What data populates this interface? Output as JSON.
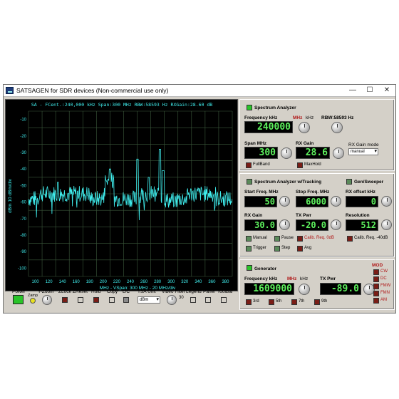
{
  "window": {
    "title": "SATSAGEN for SDR devices (Non-commercial use only)",
    "minimize": "—",
    "maximize": "☐",
    "close": "✕"
  },
  "graph": {
    "header": "SA - FCent.:240,000 kHz Span:300 MHz RBW:58593 Hz RXGain:28.60 dB",
    "footer": "MHz - VSpan: 300 MHz - 20 MHz/div",
    "ylabel": "dBm 10 dBm/div",
    "yticks": [
      "-10",
      "-20",
      "-30",
      "-40",
      "-50",
      "-60",
      "-70",
      "-80",
      "-90",
      "-100"
    ],
    "xticks": [
      "100",
      "120",
      "140",
      "160",
      "180",
      "200",
      "220",
      "240",
      "260",
      "280",
      "300",
      "320",
      "340",
      "360",
      "380"
    ],
    "trace_color": "#40f0f0"
  },
  "bottombar": {
    "power": "Power",
    "yzoom": "Y-Zoom",
    "zamp": "Zamp",
    "zlock": "ZLock",
    "zreset": "ZReset",
    "hold": "Hold",
    "copy": "Copy",
    "lc": "L/C",
    "tsa_unit": "TSA Unit",
    "tsa_value": "dBm",
    "video_filter": "Video Filter",
    "video_value": "30",
    "legend": "Legend",
    "panel": "Panel",
    "toolbar": "ToolBar"
  },
  "sa": {
    "title": "Spectrum Analyzer",
    "freq_label": "Frequency kHz",
    "unit_mhz": "MHz",
    "unit_khz": "kHz",
    "rbw": "RBW:58593 Hz",
    "freq_value": "240000",
    "span_label": "Span MHz",
    "span_value": "300",
    "gain_label": "RX Gain",
    "gain_value": "28.6",
    "gainmode_label": "RX Gain mode",
    "gainmode_value": "manual",
    "fullband": "FullBand",
    "maxhold": "MaxHold"
  },
  "tracking": {
    "title": "Spectrum Analyzer w/Tracking",
    "gen_title": "Gen/Sweeper",
    "start_label": "Start Freq. MHz",
    "start_value": "50",
    "stop_label": "Stop Freq. MHz",
    "stop_value": "6000",
    "offset_label": "RX offset kHz",
    "offset_value": "0",
    "gain_label": "RX Gain",
    "gain_value": "30.0",
    "txpwr_label": "TX Pwr",
    "txpwr_value": "-20.0",
    "res_label": "Resolution",
    "res_value": "512",
    "manual": "Manual",
    "pause": "Pause",
    "calib": "Calib. Req. 0dB",
    "calib40": "Calib. Req. -40dB",
    "trigger": "Trigger",
    "step": "Step",
    "avg": "Avg"
  },
  "generator": {
    "title": "Generator",
    "freq_label": "Frequency kHz",
    "unit_mhz": "MHz",
    "unit_khz": "kHz",
    "freq_value": "1609000",
    "txpwr_label": "TX Pwr",
    "txpwr_value": "-89.0",
    "h3": "3rd",
    "h5": "5th",
    "h7": "7th",
    "h9": "9th",
    "mod_label": "MOD",
    "mods": [
      "CW",
      "DC",
      "FMW",
      "FMN",
      "AM"
    ]
  }
}
